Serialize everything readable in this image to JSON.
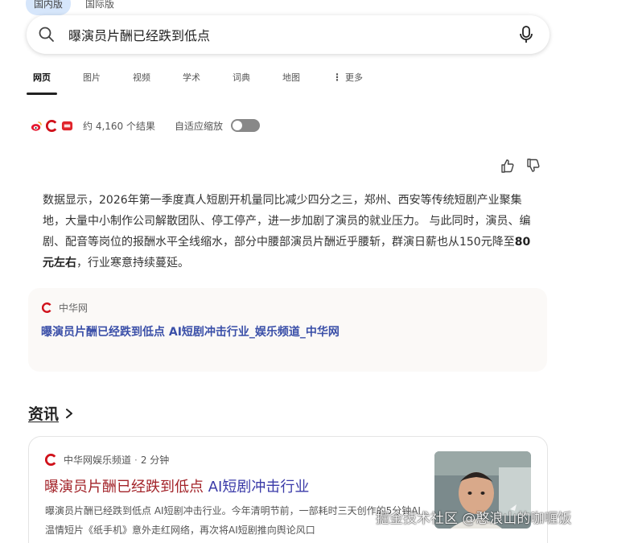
{
  "region_tabs": [
    {
      "label": "国内版",
      "active": true
    },
    {
      "label": "国际版",
      "active": false
    }
  ],
  "search": {
    "query": "曝演员片酬已经跌到低点"
  },
  "nav": {
    "items": [
      "网页",
      "图片",
      "视频",
      "学术",
      "词典",
      "地图"
    ],
    "more_label": "更多"
  },
  "stats": {
    "result_count": "约 4,160 个结果",
    "zoom_label": "自适应缩放"
  },
  "answer": {
    "part1": "数据显示，2026年第一季度真人短剧开机量同比减少四分之三，郑州、西安等传统短剧产业聚集地，大量中小制作公司解散团队、停工停产，进一步加剧了演员的就业压力。 与此同时，演员、编剧、配音等岗位的报酬水平全线缩水，部分中腰部演员片酬近乎腰斩，群演日薪也从150元降至",
    "bold": "80元左右",
    "part2": "，行业寒意持续蔓延。"
  },
  "source": {
    "site": "中华网",
    "title": "曝演员片酬已经跌到低点 AI短剧冲击行业_娱乐频道_中华网"
  },
  "news": {
    "heading": "资讯",
    "card": {
      "site": "中华网娱乐频道",
      "time": "2 分钟",
      "headline_part1": "曝演员片酬已经跌到低点 ",
      "headline_ai": "AI短剧冲击行业",
      "snippet": "曝演员片酬已经跌到低点 AI短剧冲击行业。今年清明节前，一部耗时三天创作的5分钟AI温情短片《纸手机》意外走红网络，再次将AI短剧推向舆论风口"
    }
  },
  "watermark": "掘金技术社区 @憨浪山的咖喱饭",
  "colors": {
    "link_blue": "#3a4fa8",
    "headline_red": "#a3242a",
    "accent_tab": "#d6e6fb"
  }
}
